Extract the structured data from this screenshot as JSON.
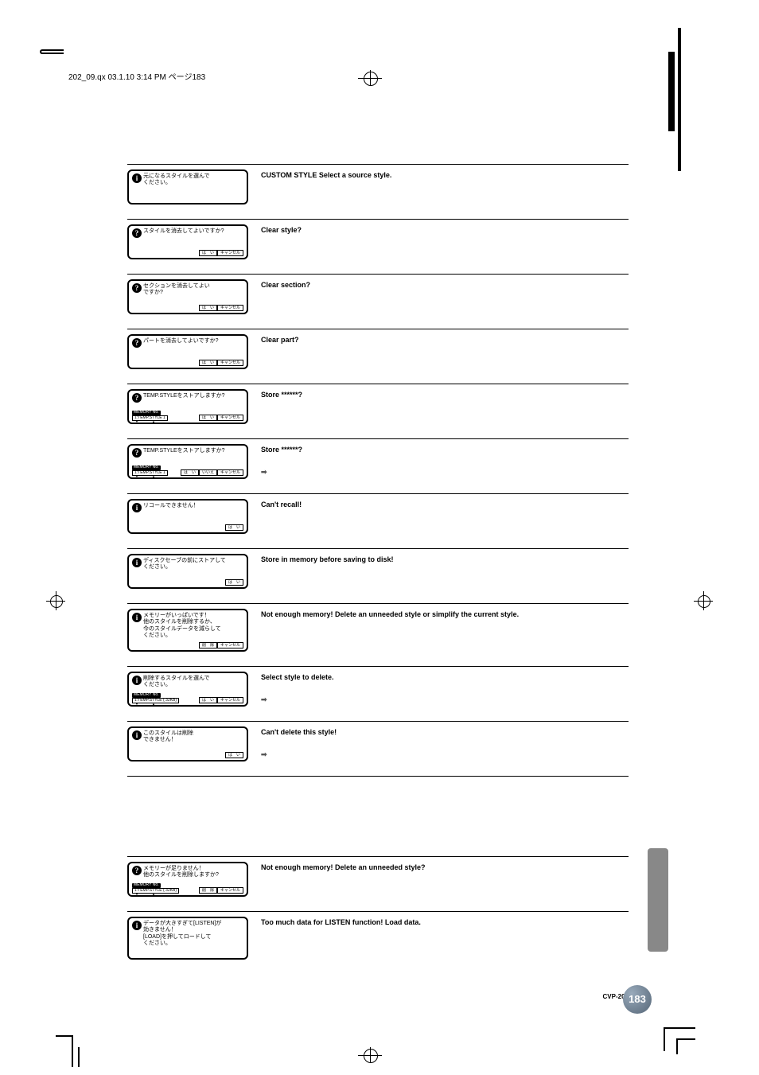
{
  "header": "202_09.qx  03.1.10  3:14 PM  ページ183",
  "footer_model": "CVP-202",
  "page_number": "183",
  "btn_yes": "は　い",
  "btn_no": "いいえ",
  "btn_cancel": "キャンセル",
  "btn_delete": "削　除",
  "memory_label": "MEMORY No.",
  "memory_box_1": "1:TEMP.STYLE  1",
  "memory_box_2": "1:TEMP.STYLE  ( 32KB)",
  "rows": [
    {
      "icon": "i",
      "jp": "元になるスタイルを選んで\nください。",
      "desc": "CUSTOM STYLE Select a source style.",
      "btns": []
    },
    {
      "icon": "?",
      "jp": "スタイルを消去してよいですか?",
      "desc": "Clear style?",
      "btns": [
        "yes",
        "cancel"
      ]
    },
    {
      "icon": "?",
      "jp": "セクションを消去してよい\nですか?",
      "desc": "Clear section?",
      "btns": [
        "yes",
        "cancel"
      ]
    },
    {
      "icon": "?",
      "jp": "パートを消去してよいですか?",
      "desc": "Clear part?",
      "btns": [
        "yes",
        "cancel"
      ]
    },
    {
      "icon": "?",
      "jp": "TEMP.STYLEをストアしますか?",
      "desc": "Store ******?",
      "btns": [
        "yes",
        "cancel"
      ],
      "mem": 1
    },
    {
      "icon": "?",
      "jp": "TEMP.STYLEをストアしますか?",
      "desc": "Store ******?",
      "btns": [
        "yes",
        "no",
        "cancel"
      ],
      "mem": 1,
      "arrow": true
    },
    {
      "icon": "i",
      "jp": "リコールできません！",
      "desc": "Can't recall!",
      "btns": [
        "yes"
      ]
    },
    {
      "icon": "i",
      "jp": "ディスクセーブの前にストアして\nください。",
      "desc": "Store in memory before saving to disk!",
      "btns": [
        "yes"
      ]
    },
    {
      "icon": "i",
      "jp": "メモリーがいっぱいです！\n他のスタイルを削除するか、\n今のスタイルデータを減らして\nください。",
      "desc": "Not enough memory! Delete an unneeded style or simplify the current style.",
      "btns": [
        "delete",
        "cancel"
      ],
      "tall": true
    },
    {
      "icon": "i",
      "jp": "削除するスタイルを選んで\nください。",
      "desc": "Select style to delete.",
      "btns": [
        "yes",
        "cancel"
      ],
      "mem": 2,
      "arrow": true
    },
    {
      "icon": "i",
      "jp": "このスタイルは削除\nできません！",
      "desc": "Can't delete this style!",
      "btns": [
        "yes"
      ],
      "arrow": true
    }
  ],
  "rows2": [
    {
      "icon": "?",
      "jp": "メモリーが足りません！\n他のスタイルを削除しますか?",
      "desc": "Not enough memory! Delete an unneeded style?",
      "btns": [
        "delete",
        "cancel"
      ],
      "mem": 2
    },
    {
      "icon": "i",
      "jp": "データが大きすぎて[LISTEN]が\n効きません！\n[LOAD]を押してロードして\nください。",
      "desc": "Too much data for LISTEN function! Load data.",
      "btns": [],
      "tall": true
    }
  ]
}
